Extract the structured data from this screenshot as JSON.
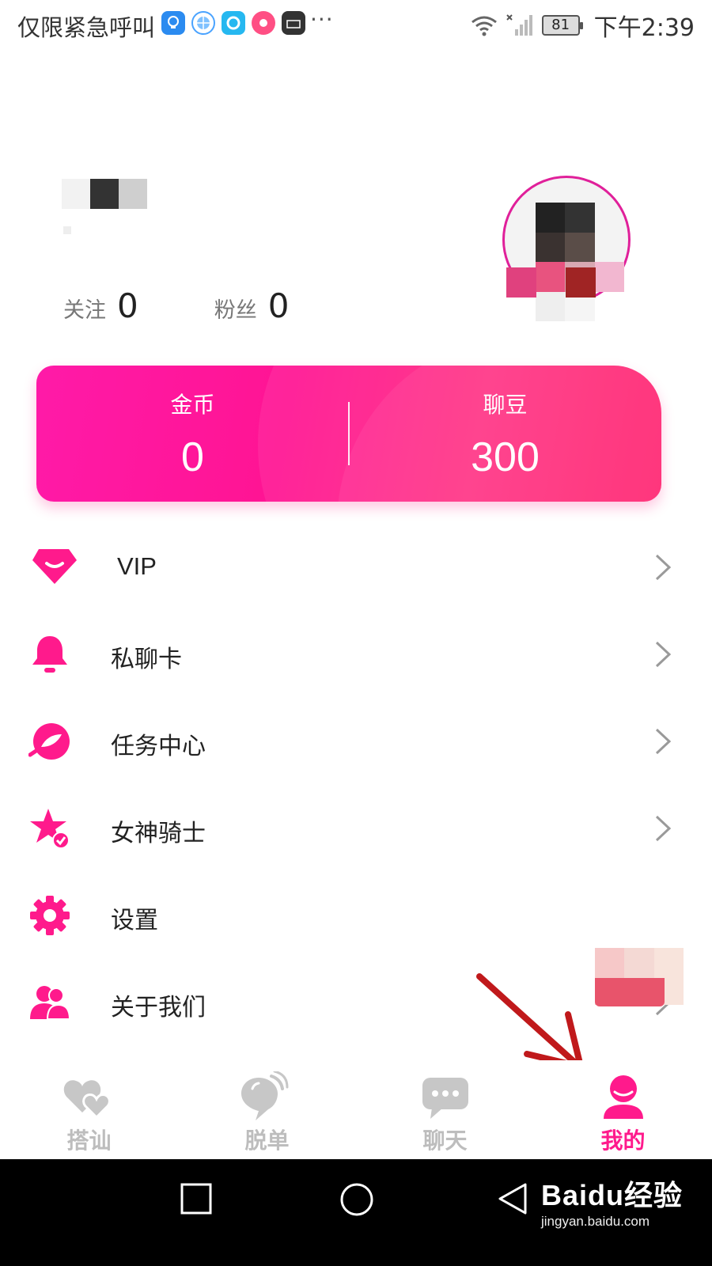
{
  "status_bar": {
    "carrier": "仅限紧急呼叫",
    "more": "···",
    "battery": "81",
    "time": "下午2:39"
  },
  "profile": {
    "follow_label": "关注",
    "follow_count": "0",
    "fans_label": "粉丝",
    "fans_count": "0"
  },
  "wallet": {
    "coins_label": "金币",
    "coins_value": "0",
    "beans_label": "聊豆",
    "beans_value": "300"
  },
  "menu": {
    "items": [
      {
        "label": "VIP",
        "icon": "diamond-icon"
      },
      {
        "label": "私聊卡",
        "icon": "bell-icon"
      },
      {
        "label": "任务中心",
        "icon": "leaf-icon"
      },
      {
        "label": "女神骑士",
        "icon": "star-check-icon"
      },
      {
        "label": "设置",
        "icon": "gear-icon"
      },
      {
        "label": "关于我们",
        "icon": "users-icon"
      }
    ]
  },
  "tabs": [
    {
      "label": "搭讪",
      "icon": "hearts-icon"
    },
    {
      "label": "脱单",
      "icon": "balloon-icon"
    },
    {
      "label": "聊天",
      "icon": "chat-icon"
    },
    {
      "label": "我的",
      "icon": "user-icon",
      "active": true
    }
  ],
  "watermark": {
    "main": "Baidu经验",
    "sub": "jingyan.baidu.com"
  },
  "colors": {
    "accent": "#ff1a8c",
    "inactive_tab": "#bdbdbd",
    "arrow": "#c0191b"
  }
}
